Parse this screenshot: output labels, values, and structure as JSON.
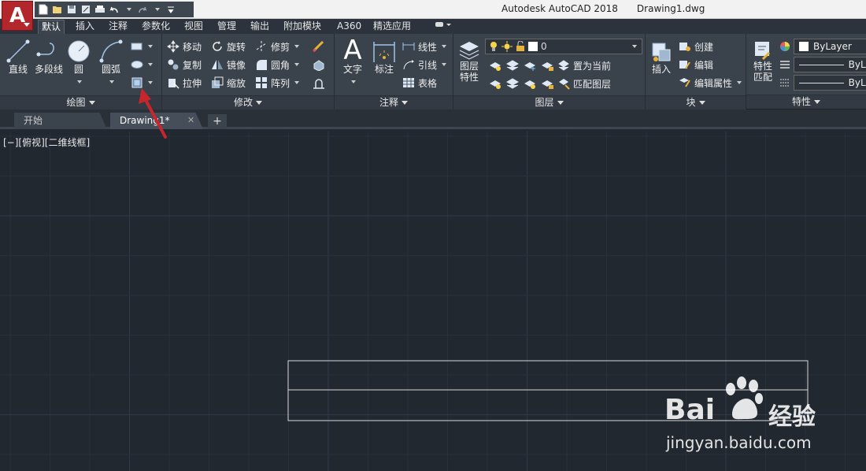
{
  "app": {
    "logo_letter": "A",
    "title": "Autodesk AutoCAD 2018",
    "file": "Drawing1.dwg"
  },
  "ribbon_tabs": [
    "默认",
    "插入",
    "注释",
    "参数化",
    "视图",
    "管理",
    "输出",
    "附加模块",
    "A360",
    "精选应用"
  ],
  "draw_panel": {
    "title": "绘图",
    "line": "直线",
    "polyline": "多段线",
    "circle": "圆",
    "arc": "圆弧"
  },
  "modify_panel": {
    "title": "修改",
    "move": "移动",
    "rotate": "旋转",
    "trim": "修剪",
    "copy": "复制",
    "mirror": "镜像",
    "fillet": "圆角",
    "stretch": "拉伸",
    "scale": "缩放",
    "array": "阵列"
  },
  "annotation_panel": {
    "title": "注释",
    "text": "文字",
    "dimension": "标注",
    "linear": "线性",
    "leader": "引线",
    "table": "表格"
  },
  "layers_panel": {
    "title": "图层",
    "layer_properties_line1": "图层",
    "layer_properties_line2": "特性",
    "current_layer": "0",
    "set_current": "置为当前",
    "match_layer": "匹配图层"
  },
  "block_panel": {
    "title": "块",
    "insert": "插入",
    "create": "创建",
    "edit": "编辑",
    "edit_attributes": "编辑属性"
  },
  "properties_panel": {
    "title": "特性",
    "match_line1": "特性",
    "match_line2": "匹配",
    "color": "ByLayer",
    "linetype": "ByLa",
    "lineweight": "ByLa"
  },
  "doc_tabs": {
    "start": "开始",
    "drawing": "Drawing1*",
    "close": "✕",
    "new": "+"
  },
  "viewport": {
    "label": "[−][俯视][二维线框]"
  },
  "watermark": {
    "brand": "Bai",
    "brand_cn": "经验",
    "url": "jingyan.baidu.com"
  },
  "colors": {
    "canvas": "#212830",
    "ribbon": "#3a424b",
    "logo": "#b3262b",
    "arrow": "#c8262d"
  }
}
